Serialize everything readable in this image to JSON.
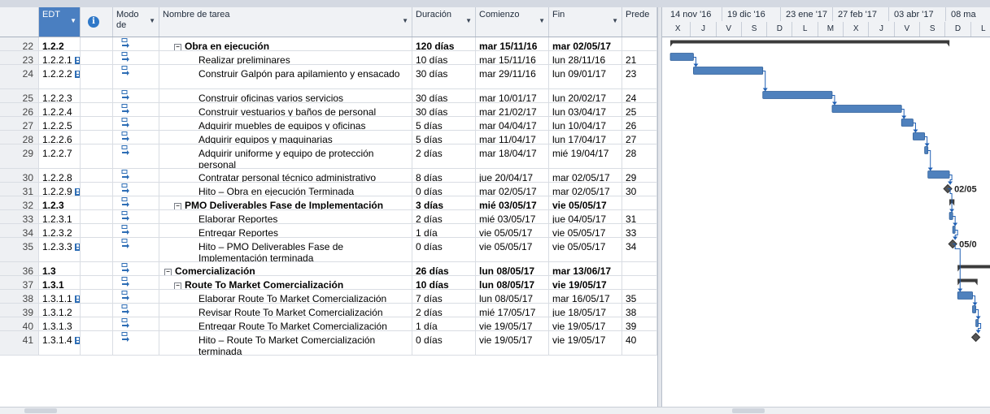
{
  "columns": {
    "id": "",
    "edt": "EDT",
    "info": "i",
    "mode": "Modo de",
    "name": "Nombre de tarea",
    "duration": "Duración",
    "start": "Comienzo",
    "finish": "Fin",
    "pred": "Prede"
  },
  "timescale": {
    "top": [
      "14 nov '16",
      "19 dic '16",
      "23 ene '17",
      "27 feb '17",
      "03 abr '17",
      "08 ma"
    ],
    "bottom": [
      "X",
      "J",
      "V",
      "S",
      "D",
      "L",
      "M",
      "X",
      "J",
      "V",
      "S",
      "D",
      "L"
    ]
  },
  "rows": [
    {
      "id": "22",
      "edt": "1.2.2",
      "note": false,
      "name": "Obra en ejecución",
      "level": 1,
      "summary": true,
      "duration": "120 días",
      "start": "mar 15/11/16",
      "finish": "mar 02/05/17",
      "pred": ""
    },
    {
      "id": "23",
      "edt": "1.2.2.1",
      "note": true,
      "name": "Realizar preliminares",
      "level": 2,
      "summary": false,
      "duration": "10 días",
      "start": "mar 15/11/16",
      "finish": "lun 28/11/16",
      "pred": "21"
    },
    {
      "id": "24",
      "edt": "1.2.2.2",
      "note": true,
      "name": "Construir Galpón para apilamiento y ensacado",
      "level": 2,
      "summary": false,
      "duration": "30 días",
      "start": "mar 29/11/16",
      "finish": "lun 09/01/17",
      "pred": "23"
    },
    {
      "id": "25",
      "edt": "1.2.2.3",
      "note": false,
      "name": "Construir oficinas varios servicios",
      "level": 2,
      "summary": false,
      "duration": "30 días",
      "start": "mar 10/01/17",
      "finish": "lun 20/02/17",
      "pred": "24"
    },
    {
      "id": "26",
      "edt": "1.2.2.4",
      "note": false,
      "name": "Construir vestuarios y baños de personal",
      "level": 2,
      "summary": false,
      "duration": "30 días",
      "start": "mar 21/02/17",
      "finish": "lun 03/04/17",
      "pred": "25"
    },
    {
      "id": "27",
      "edt": "1.2.2.5",
      "note": false,
      "name": "Adquirir muebles de equipos y oficinas",
      "level": 2,
      "summary": false,
      "duration": "5 días",
      "start": "mar 04/04/17",
      "finish": "lun 10/04/17",
      "pred": "26"
    },
    {
      "id": "28",
      "edt": "1.2.2.6",
      "note": false,
      "name": "Adquirir equipos y maquinarias",
      "level": 2,
      "summary": false,
      "duration": "5 días",
      "start": "mar 11/04/17",
      "finish": "lun 17/04/17",
      "pred": "27"
    },
    {
      "id": "29",
      "edt": "1.2.2.7",
      "note": false,
      "name": "Adquirir uniforme y equipo de protección personal",
      "level": 2,
      "summary": false,
      "duration": "2 días",
      "start": "mar 18/04/17",
      "finish": "mié 19/04/17",
      "pred": "28"
    },
    {
      "id": "30",
      "edt": "1.2.2.8",
      "note": false,
      "name": "Contratar  personal técnico administrativo",
      "level": 2,
      "summary": false,
      "duration": "8 días",
      "start": "jue 20/04/17",
      "finish": "mar 02/05/17",
      "pred": "29"
    },
    {
      "id": "31",
      "edt": "1.2.2.9",
      "note": true,
      "name": "Hito – Obra en ejecución Terminada",
      "level": 2,
      "summary": false,
      "duration": "0 días",
      "start": "mar 02/05/17",
      "finish": "mar 02/05/17",
      "pred": "30"
    },
    {
      "id": "32",
      "edt": "1.2.3",
      "note": false,
      "name": "PMO Deliverables Fase de Implementación",
      "level": 1,
      "summary": true,
      "duration": "3 días",
      "start": "mié 03/05/17",
      "finish": "vie 05/05/17",
      "pred": ""
    },
    {
      "id": "33",
      "edt": "1.2.3.1",
      "note": false,
      "name": "Elaborar  Reportes",
      "level": 2,
      "summary": false,
      "duration": "2 días",
      "start": "mié 03/05/17",
      "finish": "jue 04/05/17",
      "pred": "31"
    },
    {
      "id": "34",
      "edt": "1.2.3.2",
      "note": false,
      "name": "Entregar  Reportes",
      "level": 2,
      "summary": false,
      "duration": "1 día",
      "start": "vie 05/05/17",
      "finish": "vie 05/05/17",
      "pred": "33"
    },
    {
      "id": "35",
      "edt": "1.2.3.3",
      "note": true,
      "name": "Hito – PMO Deliverables Fase de Implementación terminada",
      "level": 2,
      "summary": false,
      "duration": "0 días",
      "start": "vie 05/05/17",
      "finish": "vie 05/05/17",
      "pred": "34"
    },
    {
      "id": "36",
      "edt": "1.3",
      "note": false,
      "name": "Comercialización",
      "level": 0,
      "summary": true,
      "duration": "26 días",
      "start": "lun 08/05/17",
      "finish": "mar 13/06/17",
      "pred": ""
    },
    {
      "id": "37",
      "edt": "1.3.1",
      "note": false,
      "name": "Route To Market Comercialización",
      "level": 1,
      "summary": true,
      "duration": "10 días",
      "start": "lun 08/05/17",
      "finish": "vie 19/05/17",
      "pred": ""
    },
    {
      "id": "38",
      "edt": "1.3.1.1",
      "note": true,
      "name": "Elaborar Route To Market Comercialización",
      "level": 2,
      "summary": false,
      "duration": "7 días",
      "start": "lun 08/05/17",
      "finish": "mar 16/05/17",
      "pred": "35"
    },
    {
      "id": "39",
      "edt": "1.3.1.2",
      "note": false,
      "name": "Revisar Route To Market Comercialización",
      "level": 2,
      "summary": false,
      "duration": "2 días",
      "start": "mié 17/05/17",
      "finish": "jue 18/05/17",
      "pred": "38"
    },
    {
      "id": "40",
      "edt": "1.3.1.3",
      "note": false,
      "name": "Entregar Route To Market Comercialización",
      "level": 2,
      "summary": false,
      "duration": "1 día",
      "start": "vie 19/05/17",
      "finish": "vie 19/05/17",
      "pred": "39"
    },
    {
      "id": "41",
      "edt": "1.3.1.4",
      "note": true,
      "name": "Hito – Route To Market Comercialización terminada",
      "level": 2,
      "summary": false,
      "duration": "0 días",
      "start": "vie 19/05/17",
      "finish": "vie 19/05/17",
      "pred": "40"
    }
  ],
  "milestone_labels": {
    "31": "02/05",
    "35": "05/0"
  },
  "colors": {
    "task_bar": "#4f81bd",
    "summary_bar": "#3b3b3b",
    "header_selected": "#4a7fc1",
    "link": "#1f5fb4"
  }
}
